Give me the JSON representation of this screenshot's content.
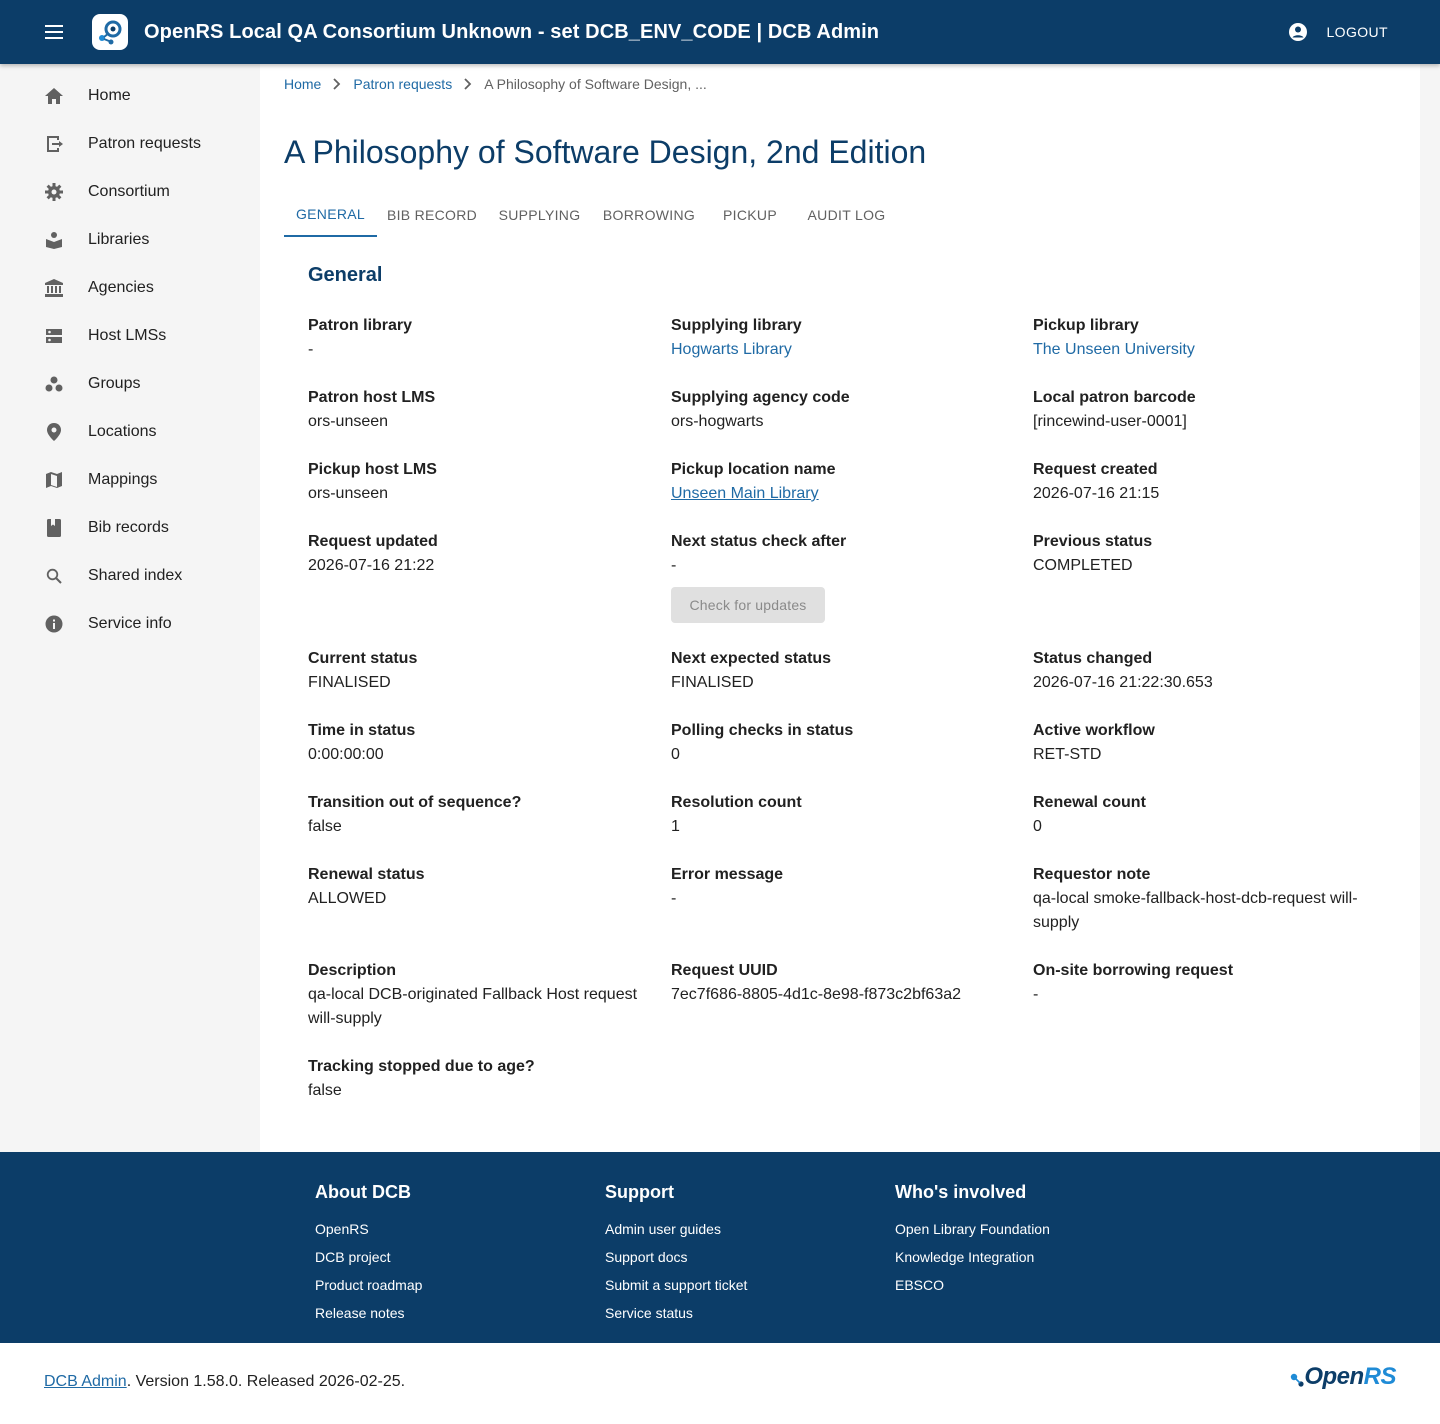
{
  "header": {
    "title": "OpenRS Local QA Consortium Unknown - set DCB_ENV_CODE | DCB Admin",
    "logout_label": "LOGOUT"
  },
  "sidebar": {
    "items": [
      {
        "label": "Home",
        "icon": "home-icon"
      },
      {
        "label": "Patron requests",
        "icon": "exit-to-app-icon"
      },
      {
        "label": "Consortium",
        "icon": "gear-icon"
      },
      {
        "label": "Libraries",
        "icon": "local-library-icon"
      },
      {
        "label": "Agencies",
        "icon": "account-balance-icon"
      },
      {
        "label": "Host LMSs",
        "icon": "dns-icon"
      },
      {
        "label": "Groups",
        "icon": "workspaces-icon"
      },
      {
        "label": "Locations",
        "icon": "location-pin-icon"
      },
      {
        "label": "Mappings",
        "icon": "map-icon"
      },
      {
        "label": "Bib records",
        "icon": "book-icon"
      },
      {
        "label": "Shared index",
        "icon": "search-icon"
      },
      {
        "label": "Service info",
        "icon": "info-icon"
      }
    ]
  },
  "breadcrumb": {
    "home": "Home",
    "patron_requests": "Patron requests",
    "current": "A Philosophy of Software Design, ..."
  },
  "page": {
    "title": "A Philosophy of Software Design, 2nd Edition"
  },
  "tabs": [
    "GENERAL",
    "BIB RECORD",
    "SUPPLYING",
    "BORROWING",
    "PICKUP",
    "AUDIT LOG"
  ],
  "general": {
    "section_title": "General",
    "check_button": "Check for updates",
    "fields": {
      "patron_library": {
        "label": "Patron library",
        "value": "-"
      },
      "supplying_library": {
        "label": "Supplying library",
        "value": "Hogwarts Library"
      },
      "pickup_library": {
        "label": "Pickup library",
        "value": "The Unseen University"
      },
      "patron_host_lms": {
        "label": "Patron host LMS",
        "value": "ors-unseen"
      },
      "supplying_agency_code": {
        "label": "Supplying agency code",
        "value": "ors-hogwarts"
      },
      "local_patron_barcode": {
        "label": "Local patron barcode",
        "value": "[rincewind-user-0001]"
      },
      "pickup_host_lms": {
        "label": "Pickup host LMS",
        "value": "ors-unseen"
      },
      "pickup_location_name": {
        "label": "Pickup location name",
        "value": "Unseen Main Library"
      },
      "request_created": {
        "label": "Request created",
        "value": "2026-07-16 21:15"
      },
      "request_updated": {
        "label": "Request updated",
        "value": "2026-07-16 21:22"
      },
      "next_status_check_after": {
        "label": "Next status check after",
        "value": "-"
      },
      "previous_status": {
        "label": "Previous status",
        "value": "COMPLETED"
      },
      "current_status": {
        "label": "Current status",
        "value": "FINALISED"
      },
      "next_expected_status": {
        "label": "Next expected status",
        "value": "FINALISED"
      },
      "status_changed": {
        "label": "Status changed",
        "value": "2026-07-16 21:22:30.653"
      },
      "time_in_status": {
        "label": "Time in status",
        "value": "0:00:00:00"
      },
      "polling_checks_in_status": {
        "label": "Polling checks in status",
        "value": "0"
      },
      "active_workflow": {
        "label": "Active workflow",
        "value": "RET-STD"
      },
      "transition_out_of_sequence": {
        "label": "Transition out of sequence?",
        "value": "false"
      },
      "resolution_count": {
        "label": "Resolution count",
        "value": "1"
      },
      "renewal_count": {
        "label": "Renewal count",
        "value": "0"
      },
      "renewal_status": {
        "label": "Renewal status",
        "value": "ALLOWED"
      },
      "error_message": {
        "label": "Error message",
        "value": "-"
      },
      "requestor_note": {
        "label": "Requestor note",
        "value": "qa-local smoke-fallback-host-dcb-request will-supply"
      },
      "description": {
        "label": "Description",
        "value": "qa-local DCB-originated Fallback Host request will-supply"
      },
      "request_uuid": {
        "label": "Request UUID",
        "value": "7ec7f686-8805-4d1c-8e98-f873c2bf63a2"
      },
      "onsite_borrowing_request": {
        "label": "On-site borrowing request",
        "value": "-"
      },
      "tracking_stopped_due_to_age": {
        "label": "Tracking stopped due to age?",
        "value": "false"
      }
    }
  },
  "footer": {
    "about": {
      "heading": "About DCB",
      "links": [
        "OpenRS",
        "DCB project",
        "Product roadmap",
        "Release notes"
      ]
    },
    "support": {
      "heading": "Support",
      "links": [
        "Admin user guides",
        "Support docs",
        "Submit a support ticket",
        "Service status"
      ]
    },
    "involved": {
      "heading": "Who's involved",
      "links": [
        "Open Library Foundation",
        "Knowledge Integration",
        "EBSCO"
      ]
    },
    "version_link": "DCB Admin",
    "version_text": ". Version 1.58.0. Released 2026-02-25.",
    "logo_open": "Open",
    "logo_rs": "RS"
  },
  "colors": {
    "primary": "#0c3d68",
    "link": "#1f6aa5"
  }
}
